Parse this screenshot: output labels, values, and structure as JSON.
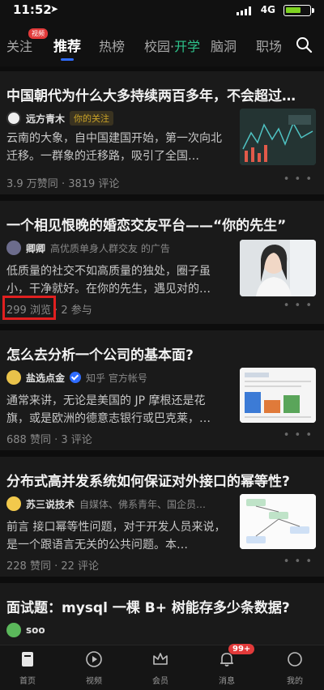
{
  "status_bar": {
    "time": "11:52",
    "network": "4G"
  },
  "tabs": {
    "items": [
      {
        "label": "关注"
      },
      {
        "label": "推荐"
      },
      {
        "label": "热榜"
      },
      {
        "label": "校园·",
        "accent": "开学"
      },
      {
        "label": "脑洞"
      },
      {
        "label": "职场"
      }
    ],
    "follow_badge": "视频",
    "active_index": 1
  },
  "feed": [
    {
      "title": "中国朝代为什么大多持续两百多年，不会超过…",
      "author": "远方青木",
      "author_tag": "你的关注",
      "excerpt": "云南的大象，自中国建国开始，第一次向北迁移。一群象的迁移路，吸引了全国…",
      "stats": "3.9 万赞同 · 3819 评论"
    },
    {
      "title": "一个相见恨晚的婚恋交友平台——“你的先生”",
      "author": "卿卿",
      "author_meta": "高优质单身人群交友 的广告",
      "excerpt": "低质量的社交不如高质量的独处，圈子虽小，干净就好。在你的先生，遇见对的…",
      "views": "299 浏览",
      "participants": "2 参与"
    },
    {
      "title": "怎么去分析一个公司的基本面?",
      "author": "盐选点金",
      "author_meta": "知乎 官方帐号",
      "excerpt": "通常来讲，无论是美国的 JP 摩根还是花旗，或是欧洲的德意志银行或巴克莱，…",
      "stats": "688 赞同 · 3 评论"
    },
    {
      "title": "分布式高并发系统如何保证对外接口的幂等性?",
      "author": "苏三说技术",
      "author_meta": "自媒体、佛系青年、国企员…",
      "excerpt": "前言 接口幂等性问题，对于开发人员来说，是一个跟语言无关的公共问题。本…",
      "stats": "228 赞同 · 22 评论"
    },
    {
      "title": "面试题：mysql 一棵 B+ 树能存多少条数据?",
      "author": "soo"
    }
  ],
  "bottom_nav": {
    "items": [
      {
        "label": "首页"
      },
      {
        "label": "视频"
      },
      {
        "label": "会员"
      },
      {
        "label": "消息"
      },
      {
        "label": "我的"
      }
    ],
    "notification_count": "99+"
  },
  "colors": {
    "background": "#0d0d0d",
    "card": "#1a1a1a",
    "accent_blue": "#2f6cff",
    "accent_green": "#2ec48c",
    "badge_red": "#e23a3a",
    "highlight_red": "#e02020"
  }
}
